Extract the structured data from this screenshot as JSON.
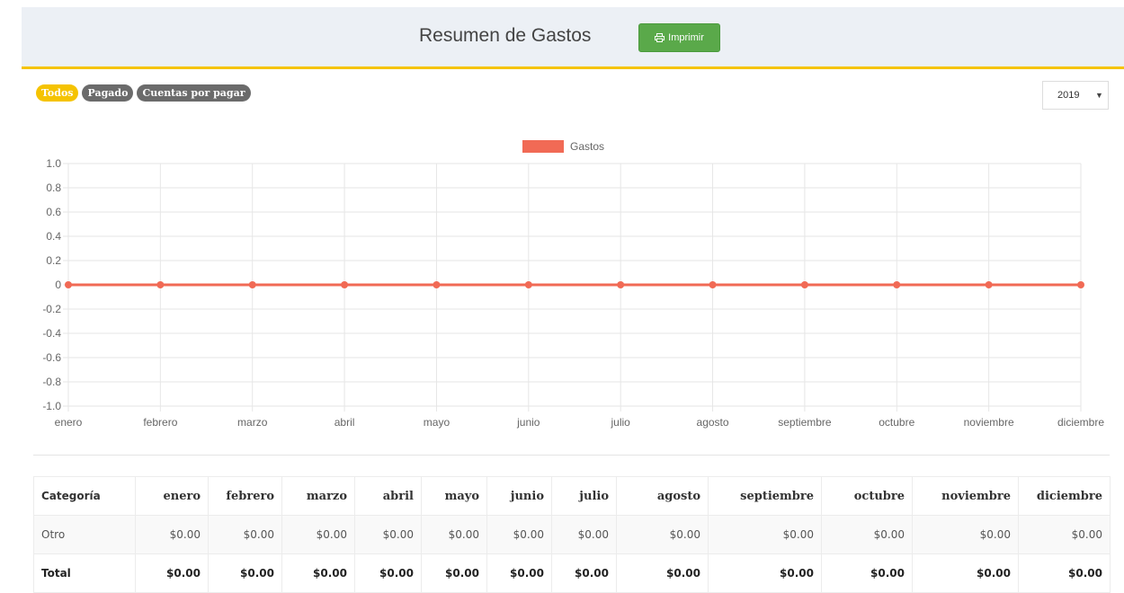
{
  "header": {
    "title": "Resumen de Gastos",
    "print_label": "Imprimir"
  },
  "filters": [
    {
      "label": "Todos",
      "active": true
    },
    {
      "label": "Pagado",
      "active": false
    },
    {
      "label": "Cuentas por pagar",
      "active": false
    }
  ],
  "year_select": {
    "value": "2019"
  },
  "colors": {
    "accent": "#f5c300",
    "series": "#f16a55",
    "print_button": "#5aa94a"
  },
  "chart_data": {
    "type": "line",
    "categories": [
      "enero",
      "febrero",
      "marzo",
      "abril",
      "mayo",
      "junio",
      "julio",
      "agosto",
      "septiembre",
      "octubre",
      "noviembre",
      "diciembre"
    ],
    "series": [
      {
        "name": "Gastos",
        "values": [
          0,
          0,
          0,
          0,
          0,
          0,
          0,
          0,
          0,
          0,
          0,
          0
        ]
      }
    ],
    "ylim": [
      -1.0,
      1.0
    ],
    "yticks": [
      "1.0",
      "0.8",
      "0.6",
      "0.4",
      "0.2",
      "0",
      "-0.2",
      "-0.4",
      "-0.6",
      "-0.8",
      "-1.0"
    ],
    "grid": true,
    "legend": "top-center"
  },
  "table": {
    "headers": [
      "Categoría",
      "enero",
      "febrero",
      "marzo",
      "abril",
      "mayo",
      "junio",
      "julio",
      "agosto",
      "septiembre",
      "octubre",
      "noviembre",
      "diciembre"
    ],
    "rows": [
      {
        "cells": [
          "Otro",
          "$0.00",
          "$0.00",
          "$0.00",
          "$0.00",
          "$0.00",
          "$0.00",
          "$0.00",
          "$0.00",
          "$0.00",
          "$0.00",
          "$0.00",
          "$0.00"
        ]
      },
      {
        "cells": [
          "Total",
          "$0.00",
          "$0.00",
          "$0.00",
          "$0.00",
          "$0.00",
          "$0.00",
          "$0.00",
          "$0.00",
          "$0.00",
          "$0.00",
          "$0.00",
          "$0.00"
        ]
      }
    ]
  }
}
